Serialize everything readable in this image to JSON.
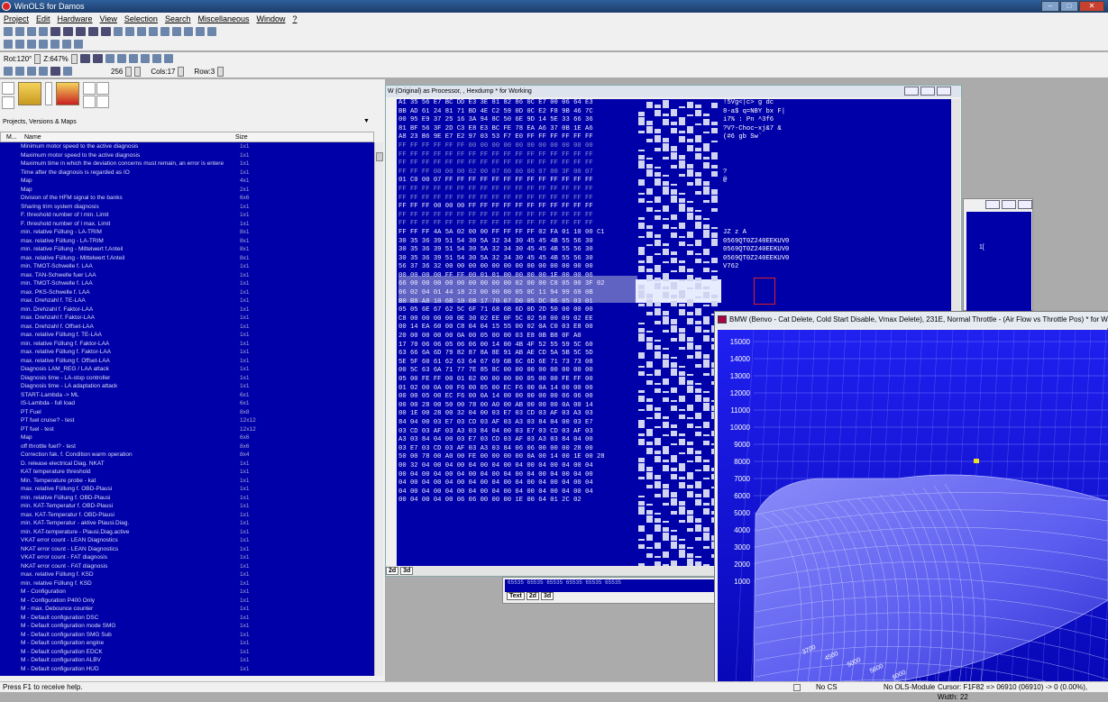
{
  "window": {
    "title": "WinOLS for Damos",
    "min": "–",
    "max": "□",
    "close": "✕"
  },
  "menu": [
    "Project",
    "Edit",
    "Hardware",
    "View",
    "Selection",
    "Search",
    "Miscellaneous",
    "Window",
    "?"
  ],
  "toolbar3": {
    "rot": "Rot:120°",
    "z": "Z:647%",
    "spin1": "◆",
    "spin2": "◆"
  },
  "toolbar4": {
    "value": "256",
    "cols": "Cols:17",
    "rows": "Row:3"
  },
  "left": {
    "dropdown_label": "Projects, Versions & Maps",
    "dropdown_arrow": "▼",
    "col_m": "M...",
    "col_name": "Name",
    "col_size": "Size",
    "rows": [
      {
        "n": "Minimum motor speed to the active diagnosis",
        "s": "1x1"
      },
      {
        "n": "Maximum motor speed to the active diagnosis",
        "s": "1x1"
      },
      {
        "n": "Maximum time in which the deviation concerns must remain, an error is entere",
        "s": "1x1"
      },
      {
        "n": "Time after the diagnosis is regarded as IO",
        "s": "1x1"
      },
      {
        "n": "Map",
        "s": "4x1"
      },
      {
        "n": "Map",
        "s": "2x1"
      },
      {
        "n": "Division of the HFM signal to the banks",
        "s": "6x6"
      },
      {
        "n": "Sharing trim system diagnosis",
        "s": "1x1"
      },
      {
        "n": "F. threshold number of l min. Limit",
        "s": "1x1"
      },
      {
        "n": "F. threshold number of l max. Limit",
        "s": "1x1"
      },
      {
        "n": "min. relative Füllung - LA-TRIM",
        "s": "8x1"
      },
      {
        "n": "max. relative Füllung - LA-TRIM",
        "s": "8x1"
      },
      {
        "n": "min. relative Füllung - Mittelwert f.Anteil",
        "s": "8x1"
      },
      {
        "n": "max. relative Füllung - Mittelwert f.Anteil",
        "s": "8x1"
      },
      {
        "n": "min. TMOT-Schwelle f. LAA",
        "s": "1x1"
      },
      {
        "n": "max. TAN-Schwelle fuer LAA",
        "s": "1x1"
      },
      {
        "n": "min. TMOT-Schwelle f. LAA",
        "s": "1x1"
      },
      {
        "n": "max. PKS-Schwelle f. LAA",
        "s": "1x1"
      },
      {
        "n": "max. Drehzahl f. TE-LAA",
        "s": "1x1"
      },
      {
        "n": "min. Drehzahl f. Faktor-LAA",
        "s": "1x1"
      },
      {
        "n": "max. Drehzahl f. Faktor-LAA",
        "s": "1x1"
      },
      {
        "n": "max. Drehzahl f. Offset-LAA",
        "s": "1x1"
      },
      {
        "n": "max. relative Füllung f. TE-LAA",
        "s": "1x1"
      },
      {
        "n": "min. relative Füllung f. Faktor-LAA",
        "s": "1x1"
      },
      {
        "n": "max. relative Füllung f. Faktor-LAA",
        "s": "1x1"
      },
      {
        "n": "max. relative Füllung f. Offset-LAA",
        "s": "1x1"
      },
      {
        "n": "Diagnosis LAM_REG / LAA attack",
        "s": "1x1"
      },
      {
        "n": "Diagnosis time - LA-stop controller",
        "s": "1x1"
      },
      {
        "n": "Diagnosis time - LA adaptation attack",
        "s": "1x1"
      },
      {
        "n": "START-Lambda -> ML",
        "s": "6x1"
      },
      {
        "n": "IS-Lambda - full load",
        "s": "6x1"
      },
      {
        "n": "PT Fuel",
        "s": "8x8"
      },
      {
        "n": "PT fuel cruise? - test",
        "s": "12x12"
      },
      {
        "n": "PT fuel - test",
        "s": "12x12"
      },
      {
        "n": "Map",
        "s": "6x6"
      },
      {
        "n": "off throttle fuel? - test",
        "s": "8x6"
      },
      {
        "n": "Correction fak. f. Condition warm operation",
        "s": "8x4"
      },
      {
        "n": "D. release electrical Diag. NKAT",
        "s": "1x1"
      },
      {
        "n": "KAT temperature threshold",
        "s": "1x1"
      },
      {
        "n": "Min. Temperature probe - kat",
        "s": "1x1"
      },
      {
        "n": "max. relative Füllung f. OBD-Plausi",
        "s": "1x1"
      },
      {
        "n": "min. relative Füllung f. OBD-Plausi",
        "s": "1x1"
      },
      {
        "n": "min. KAT-Temperatur f. OBD-Plausi",
        "s": "1x1"
      },
      {
        "n": "max. KAT-Temperatur f. OBD-Plausi",
        "s": "1x1"
      },
      {
        "n": "min. KAT-Temperatur - aktive Plausi.Diag.",
        "s": "1x1"
      },
      {
        "n": "min. KAT-temperature - Plausi.Diag.active",
        "s": "1x1"
      },
      {
        "n": "VKAT error count - LEAN Diagnostics",
        "s": "1x1"
      },
      {
        "n": "NKAT error count - LEAN Diagnostics",
        "s": "1x1"
      },
      {
        "n": "VKAT error count - FAT diagnosis",
        "s": "1x1"
      },
      {
        "n": "NKAT error count - FAT diagnosis",
        "s": "1x1"
      },
      {
        "n": "max. relative Füllung f. KSD",
        "s": "1x1"
      },
      {
        "n": "min. relative Füllung f. KSD",
        "s": "1x1"
      },
      {
        "n": "M - Configuration",
        "s": "1x1"
      },
      {
        "n": "M - Configuration P400 Only",
        "s": "1x1"
      },
      {
        "n": "M - max. Debounce counter",
        "s": "1x1"
      },
      {
        "n": "M - Default configuration DSC",
        "s": "1x1"
      },
      {
        "n": "M - Default configuration mode SMG",
        "s": "1x1"
      },
      {
        "n": "M - Default configuration SMG Sub",
        "s": "1x1"
      },
      {
        "n": "M - Default configuration engine",
        "s": "1x1"
      },
      {
        "n": "M - Default configuration EDCK",
        "s": "1x1"
      },
      {
        "n": "M - Default configuration ALBV",
        "s": "1x1"
      },
      {
        "n": "M - Default configuration HUD",
        "s": "1x1"
      }
    ]
  },
  "hex": {
    "title": "W (Original) as Processor, , Hexdump * for Working",
    "lines": [
      {
        "h": "A1 35 56 E7 BC DD E3 3E 81 82 86 0C E7 00 06 64 E3",
        "a": "!5Vg<|c>    g  dc"
      },
      {
        "h": "BB AD 61 24 81 71 BD 4E C2 59 0D 0C E2 F8 9B 46 7C",
        "a": "8-a$ q=NBY  bx F|"
      },
      {
        "h": "00 95 E9 37 25 16 3A 94 8C 50 6E 9D 14 5E 33 66 36",
        "a": " i7% :  Pn  ^3f6"
      },
      {
        "h": "81 BF 56 3F 2D C3 E8 E3 BC FE 78 EA A6 37 0B 1E A6",
        "a": " ?V?-Choc~xj&7  &"
      },
      {
        "h": "A8 23 B6 9E E7 E2 97 03 53 F7 E0 FF FF FF FF FF FF",
        "a": "(#6 gb  Sw`"
      },
      {
        "h": "FF FF FF FF FF FF 00 00 00 00 00 00 00 00 00 00 00",
        "a": "",
        "f": 1
      },
      {
        "h": "FF FF FF FF FF FF FF FF FF FF FF FF FF FF FF FF FF",
        "a": "",
        "f": 1
      },
      {
        "h": "FF FF FF FF FF FF FF FF FF FF FF FF FF FF FF FF FF",
        "a": "",
        "f": 1
      },
      {
        "h": "FF FF FF 00 00 00 02 00 07 00 00 00 07 00 3F 00 07",
        "a": "                  ?",
        "f": 1
      },
      {
        "h": "01 C0 00 07 FF FF FF FF FF FF FF FF FF FF FF FF FF",
        "a": "  @"
      },
      {
        "h": "FF FF FF FF FF FF FF FF FF FF FF FF FF FF FF FF FF",
        "a": "",
        "f": 1
      },
      {
        "h": "FF FF FF FF FF FF FF FF FF FF FF FF FF FF FF FF FF",
        "a": "",
        "f": 1
      },
      {
        "h": "FF FF FF 00 00 00 FF FF FF FF FF FF FF FF FF FF FF",
        "a": ""
      },
      {
        "h": "FF FF FF FF FF FF FF FF FF FF FF FF FF FF FF FF FF",
        "a": "",
        "f": 1
      },
      {
        "h": "FF FF FF FF FF FF FF FF FF FF FF FF FF FF FF FF FF",
        "a": "",
        "f": 1
      },
      {
        "h": "FF FF FF 4A 5A 02 00 00 FF FF FF FF 02 FA 01 10 00 C1",
        "a": " JZ         z  A"
      },
      {
        "h": "30 35 36 39 51 54 30 5A 32 34 30 45 45 4B 55 56 30",
        "a": "0569QT0Z240EEKUV0"
      },
      {
        "h": "30 35 36 39 51 54 30 5A 32 34 30 45 45 4B 55 56 30",
        "a": "0569QT0Z240EEKUV0"
      },
      {
        "h": "30 35 36 39 51 54 30 5A 32 34 30 45 45 4B 55 56 30",
        "a": "0569QT0Z240EEKUV0"
      },
      {
        "h": "56 37 36 32 00 00 00 00 00 00 00 00 00 00 00 00 00",
        "a": "V762"
      },
      {
        "h": "00 00 00 00 FF FF 00 01 01 00 00 00 00 1E 00 00 06",
        "a": ""
      },
      {
        "h": "66 00 00 00 00 00 00 00 00 00 02 00 00 C8 05 00 3F 02",
        "a": ""
      },
      {
        "h": "06 02 04 01 44 18 23 00 00 00 05 0C 11 94 99 69 0B",
        "a": ""
      },
      {
        "h": "B0 B8 A8 10 6B 10 6B 17 70 07 D0 05 DC 06 05 03 01",
        "a": ""
      },
      {
        "h": "05 05 6E 67 62 5C 6F 71 68 6B 6D 0D 2D 50 00 00 00",
        "a": ""
      },
      {
        "h": "C8 00 00 00 00 0E 30 02 EE 0F 5C 02 58 00 09 02 EE",
        "a": ""
      },
      {
        "h": "00 14 EA 60 00 C8 04 04 15 55 00 02 0A C0 03 E8 00",
        "a": ""
      },
      {
        "h": "20 00 00 00 00 0A 00 05 00 00 03 E8 0B B8 0F A0",
        "a": ""
      },
      {
        "h": "17 70 06 06 05 06 06 00 14 00 4B 4F 52 55 59 5C 60",
        "a": ""
      },
      {
        "h": "63 66 6A 6D 79 82 87 8A 8E 91 AB AE CD 5A 5B 5C 5D",
        "a": ""
      },
      {
        "h": "5E 5F 60 61 62 63 64 67 69 6B 6C 6D 6E 71 73 73 08",
        "a": ""
      },
      {
        "h": "00 5C 63 6A 71 77 7E 85 8C 00 00 00 00 00 00 00 00",
        "a": ""
      },
      {
        "h": "05 00 FE FF 00 01 02 00 00 00 00 05 00 00 FE FF 00",
        "a": ""
      },
      {
        "h": "01 02 00 0A 00 F6 00 05 00 EC F6 00 0A 14 00 00 00",
        "a": ""
      },
      {
        "h": "00 00 05 00 EC F6 00 0A 14 00 00 00 00 00 06 06 00",
        "a": ""
      },
      {
        "h": "00 00 28 00 50 00 78 00 A0 00 AB 00 00 00 0A 00 14",
        "a": ""
      },
      {
        "h": "00 1E 00 28 00 32 04 00 03 E7 03 CD 03 AF 03 A3 03",
        "a": ""
      },
      {
        "h": "84 04 00 03 E7 03 CD 03 AF 03 A3 03 84 04 00 03 E7",
        "a": ""
      },
      {
        "h": "03 CD 03 AF 03 A3 03 84 04 00 03 E7 03 CD 03 AF 03",
        "a": ""
      },
      {
        "h": "A3 03 84 04 00 03 E7 03 CD 03 AF 03 A3 03 84 04 00",
        "a": ""
      },
      {
        "h": "03 E7 03 CD 03 AF 03 A3 03 84 06 06 00 00 00 28 00",
        "a": ""
      },
      {
        "h": "50 00 78 00 A0 00 FE 00 00 00 00 0A 00 14 00 1E 00 28",
        "a": ""
      },
      {
        "h": "00 32 04 00 04 00 04 00 04 00 04 00 04 00 04 00 04",
        "a": ""
      },
      {
        "h": "00 04 00 04 00 04 00 04 00 04 00 04 00 04 00 04 00",
        "a": ""
      },
      {
        "h": "04 00 04 00 04 00 04 00 04 00 04 00 04 00 04 00 04",
        "a": ""
      },
      {
        "h": "04 00 04 00 04 00 04 00 04 00 04 00 04 00 04 00 04",
        "a": ""
      },
      {
        "h": "00 04 00 04 00 06 06 00 00 00 1E 00 64 01 2C 02",
        "a": ""
      }
    ],
    "tab1": "2d",
    "tab2": "3d"
  },
  "textwin": {
    "line": "65535 65535 65535 65535 65535 65535",
    "tab1": "Text",
    "tab2": "2d",
    "tab3": "3d"
  },
  "smallwin": {
    "text": "1["
  },
  "graph": {
    "title": "BMW (Benvo - Cat Delete, Cold Start Disable, Vmax Delete), 231E, Normal Throttle -  (Air Flow vs Throttle Pos) * for Working",
    "yticks": [
      "15000",
      "14000",
      "13000",
      "12000",
      "11000",
      "10000",
      "9000",
      "8000",
      "7000",
      "6000",
      "5000",
      "4000",
      "3000",
      "2000",
      "1000"
    ],
    "xticks": [
      "3700",
      "4500",
      "5000",
      "5600",
      "6000"
    ]
  },
  "status": {
    "help": "Press F1 to receive help.",
    "cs": "No CS",
    "module": "No OLS-Module",
    "cursor": "Cursor: F1F82 => 06910 (06910) -> 0 (0.00%), Width: 22"
  },
  "colors": {
    "listbg": "#0000a8",
    "surface": "#5a5af0",
    "highlight": "#e02020"
  }
}
